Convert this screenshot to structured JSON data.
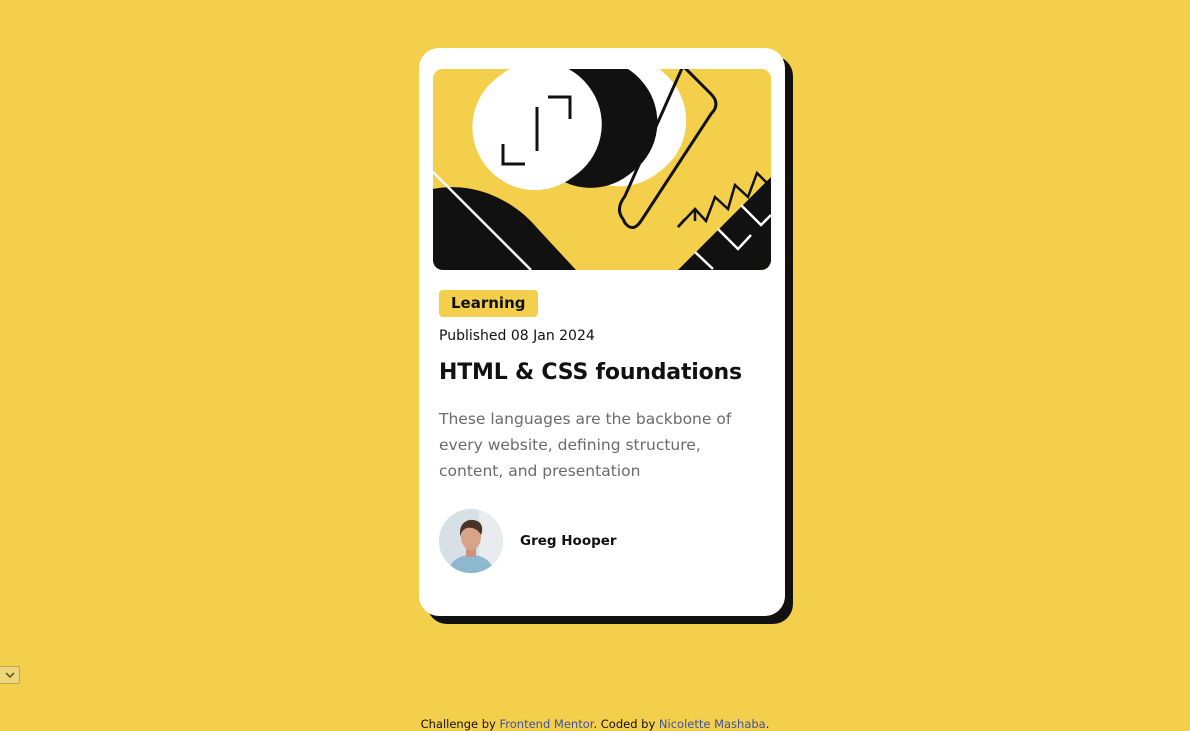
{
  "card": {
    "tag": "Learning",
    "published": "Published 08 Jan 2024",
    "title": "HTML & CSS foundations",
    "description": "These languages are the backbone of every website, defining structure, content, and presentation",
    "author": "Greg Hooper"
  },
  "icons": {
    "hero": "abstract-illustration-icon",
    "avatar": "author-photo",
    "dropdown": "chevron-down-icon"
  },
  "footer": {
    "prefix": "Challenge by",
    "link1": "Frontend Mentor",
    "middle": ". Coded by",
    "link2": "Nicolette Mashaba",
    "suffix": "."
  },
  "colors": {
    "background": "#F4CF4B",
    "card": "#FFFFFF",
    "ink": "#111111",
    "muted": "#6B6B6B",
    "link": "#3E52A3"
  }
}
